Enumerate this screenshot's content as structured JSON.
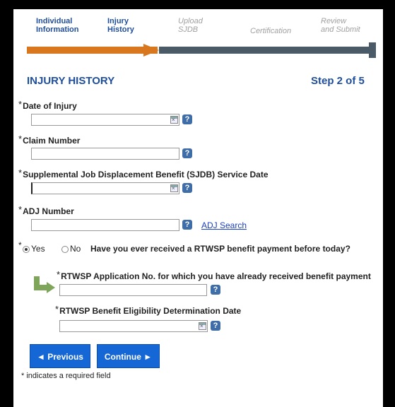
{
  "progress": {
    "steps": [
      {
        "label_1": "Individual",
        "label_2": "Information"
      },
      {
        "label_1": "Injury",
        "label_2": "History"
      },
      {
        "label_1": "Upload",
        "label_2": "SJDB"
      },
      {
        "label_1": "Certification",
        "label_2": ""
      },
      {
        "label_1": "Review",
        "label_2": "and Submit"
      }
    ],
    "current_step": 2,
    "total_steps": 5
  },
  "header": {
    "title": "INJURY HISTORY",
    "step_text": "Step 2 of 5"
  },
  "form": {
    "required_mark": "*",
    "date_of_injury": {
      "label": "Date of Injury",
      "value": ""
    },
    "claim_number": {
      "label": "Claim Number",
      "value": ""
    },
    "sjdb_service_date": {
      "label": "Supplemental Job Displacement Benefit (SJDB) Service Date",
      "value": ""
    },
    "adj_number": {
      "label": "ADJ Number",
      "value": "",
      "link": "ADJ Search"
    },
    "prior_payment": {
      "options": [
        "Yes",
        "No"
      ],
      "selected": "Yes",
      "question": "Have you ever received a RTWSP benefit payment before today?"
    },
    "rtwsp_application_no": {
      "label": "RTWSP Application No. for which you have already received benefit payment",
      "value": ""
    },
    "rtwsp_eligibility_date": {
      "label": "RTWSP Benefit Eligibility Determination Date",
      "value": ""
    },
    "help_glyph": "?"
  },
  "buttons": {
    "previous": "◄ Previous",
    "continue": "Continue ►"
  },
  "footnote": "* indicates a required field",
  "colors": {
    "title_blue": "#1f4e9c",
    "progress_done": "#d8771e",
    "progress_todo": "#4a5a66",
    "button_blue": "#1667d6",
    "elbow_green": "#7ea55a"
  }
}
